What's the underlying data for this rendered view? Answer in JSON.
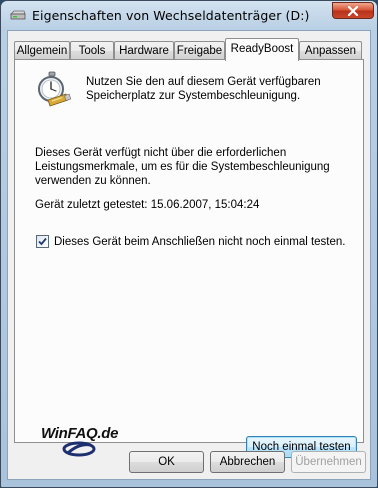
{
  "window": {
    "title": "Eigenschaften von Wechseldatenträger (D:)"
  },
  "tabs": [
    {
      "label": "Allgemein"
    },
    {
      "label": "Tools"
    },
    {
      "label": "Hardware"
    },
    {
      "label": "Freigabe"
    },
    {
      "label": "ReadyBoost",
      "active": true
    },
    {
      "label": "Anpassen"
    }
  ],
  "readyboost": {
    "intro_line1": "Nutzen Sie den auf diesem Gerät verfügbaren",
    "intro_line2": "Speicherplatz zur Systembeschleunigung.",
    "info_line1": "Dieses Gerät verfügt nicht über die erforderlichen",
    "info_line2": "Leistungsmerkmale, um es für die Systembeschleunigung",
    "info_line3": "verwenden zu können.",
    "last_tested": "Gerät zuletzt getestet: 15.06.2007, 15:04:24",
    "checkbox_label": "Dieses Gerät beim Anschließen nicht noch einmal testen.",
    "checkbox_checked": true,
    "retest_button": "Noch einmal testen"
  },
  "watermark": {
    "text": "WinFAQ.de"
  },
  "buttons": {
    "ok": "OK",
    "cancel": "Abbrechen",
    "apply": "Übernehmen"
  }
}
